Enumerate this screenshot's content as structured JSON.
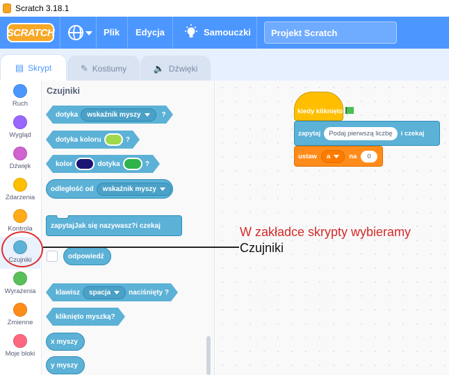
{
  "window": {
    "title": "Scratch 3.18.1"
  },
  "menubar": {
    "logo": "SCRATCH",
    "language_icon": "globe-icon",
    "file": "Plik",
    "edit": "Edycja",
    "tutorials": "Samouczki",
    "project_title": "Projekt Scratch"
  },
  "tabs": [
    {
      "label": "Skrypt",
      "active": true
    },
    {
      "label": "Kostiumy",
      "active": false
    },
    {
      "label": "Dźwięki",
      "active": false
    }
  ],
  "categories": [
    {
      "label": "Ruch",
      "color": "#4c97ff"
    },
    {
      "label": "Wygląd",
      "color": "#9966ff"
    },
    {
      "label": "Dźwięk",
      "color": "#cf63cf"
    },
    {
      "label": "Zdarzenia",
      "color": "#ffbf00"
    },
    {
      "label": "Kontrola",
      "color": "#ffab19"
    },
    {
      "label": "Czujniki",
      "color": "#5cb1d6",
      "active": true
    },
    {
      "label": "Wyrażenia",
      "color": "#59c059"
    },
    {
      "label": "Zmienne",
      "color": "#ff8c1a"
    },
    {
      "label": "Moje bloki",
      "color": "#ff6680"
    }
  ],
  "palette": {
    "title": "Czujniki",
    "touching": {
      "prefix": "dotyka",
      "dropdown": "wskaźnik myszy",
      "suffix": "?"
    },
    "touching_color": {
      "prefix": "dotyka koloru",
      "suffix": "?",
      "swatch_color": "#9fd84a"
    },
    "color_touching": {
      "prefix": "kolor",
      "middle": "dotyka",
      "suffix": "?",
      "color1": "#1a1575",
      "color2": "#2fb34a"
    },
    "distance": {
      "prefix": "odległość od",
      "dropdown": "wskaźnik myszy"
    },
    "ask": {
      "prefix": "zapytaj",
      "input": "Jak się nazywasz?",
      "suffix": "i czekaj"
    },
    "answer": "odpowiedź",
    "key_pressed": {
      "prefix": "klawisz",
      "dropdown": "spacja",
      "suffix": "naciśnięty ?"
    },
    "mouse_down": "kliknięto myszką?",
    "mouse_x": "x myszy",
    "mouse_y": "y myszy"
  },
  "script": {
    "hat": "kiedy kliknięto",
    "ask": {
      "prefix": "zapytaj",
      "input": "Podaj pierwszą liczbę",
      "suffix": "i czekaj"
    },
    "set": {
      "prefix": "ustaw",
      "variable": "a",
      "middle": "na",
      "value": "0"
    }
  },
  "annotation": {
    "line1": "W zakładce skrypty wybieramy",
    "line2": "Czujniki",
    "color": "#d42a2a"
  }
}
